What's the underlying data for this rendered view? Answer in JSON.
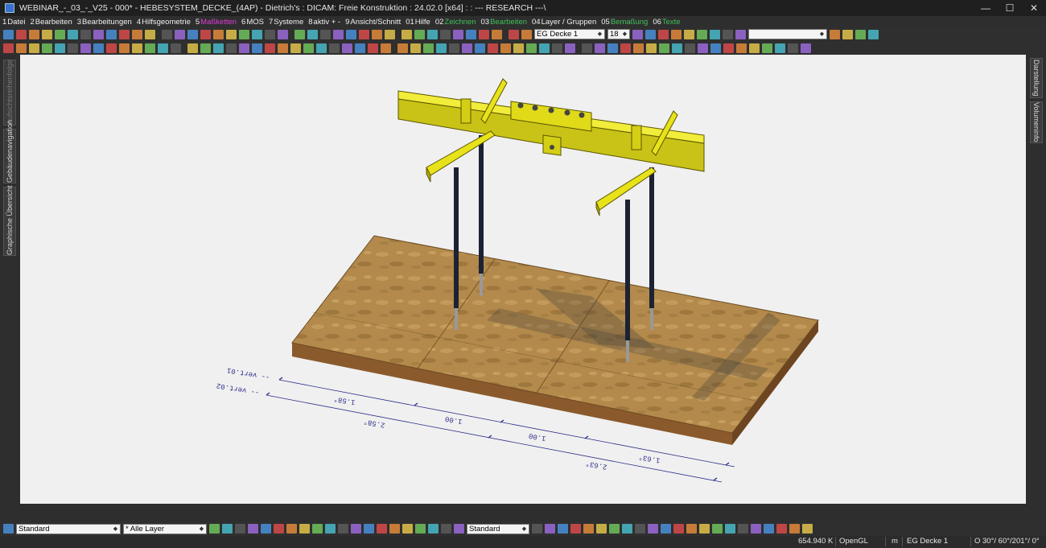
{
  "window": {
    "title": "WEBINAR_-_03_-_V25 - 000* - HEBESYSTEM_DECKE_(4AP) - Dietrich's : DICAM: Freie Konstruktion : 24.02.0 [x64] : : --- RESEARCH ---\\",
    "minimize": "—",
    "maximize": "☐",
    "close": "✕"
  },
  "menu": [
    {
      "num": "1",
      "label": "Datei",
      "color": "#f0f0f0"
    },
    {
      "num": "2",
      "label": "Bearbeiten",
      "color": "#f0f0f0"
    },
    {
      "num": "3",
      "label": "Bearbeitungen",
      "color": "#f0f0f0"
    },
    {
      "num": "4",
      "label": "Hilfsgeometrie",
      "color": "#f0f0f0"
    },
    {
      "num": "5",
      "label": "Maßketten",
      "color": "#e23cd9"
    },
    {
      "num": "6",
      "label": "MOS",
      "color": "#f0f0f0"
    },
    {
      "num": "7",
      "label": "Systeme",
      "color": "#f0f0f0"
    },
    {
      "num": "8",
      "label": "aktiv + -",
      "color": "#f0f0f0"
    },
    {
      "num": "9",
      "label": "Ansicht/Schnitt",
      "color": "#f0f0f0"
    },
    {
      "num": "01",
      "label": "Hilfe",
      "color": "#f0f0f0"
    },
    {
      "num": "02",
      "label": "Zeichnen",
      "color": "#3fc25a"
    },
    {
      "num": "03",
      "label": "Bearbeiten",
      "color": "#3fc25a"
    },
    {
      "num": "04",
      "label": "Layer / Gruppen",
      "color": "#f0f0f0"
    },
    {
      "num": "05",
      "label": "Bemaßung",
      "color": "#3fc25a"
    },
    {
      "num": "06",
      "label": "Texte",
      "color": "#3fc25a"
    }
  ],
  "toolbar": {
    "storey_select": "EG Decke 1",
    "number_select": "18",
    "blank_select": ""
  },
  "left_tabs": [
    "Aufsichtsreihenfolge",
    "Gebäudenavigation",
    "Graphische Übersicht"
  ],
  "right_tabs": [
    "Darstellung",
    "Volumeninfo"
  ],
  "dimensions": {
    "row1_label": "-- vert.01",
    "row2_label": "-- vert.02",
    "values_row1": [
      "1.58°",
      "1.00",
      "1.00",
      "1.63°"
    ],
    "values_row2": [
      "2.58°",
      "2.63°"
    ]
  },
  "bottom_toolbar": {
    "style_select": "Standard",
    "layer_select": "* Alle Layer",
    "line_select": "Standard"
  },
  "status": {
    "coord": "654.940 K",
    "renderer": "OpenGL",
    "unit": "m",
    "storey": "EG Decke 1",
    "view": "O 30°/ 60°/201°/ 0°"
  },
  "colors": {
    "yellow": "#e8e21a",
    "wood": "#b08848",
    "rod": "#1c2233"
  }
}
